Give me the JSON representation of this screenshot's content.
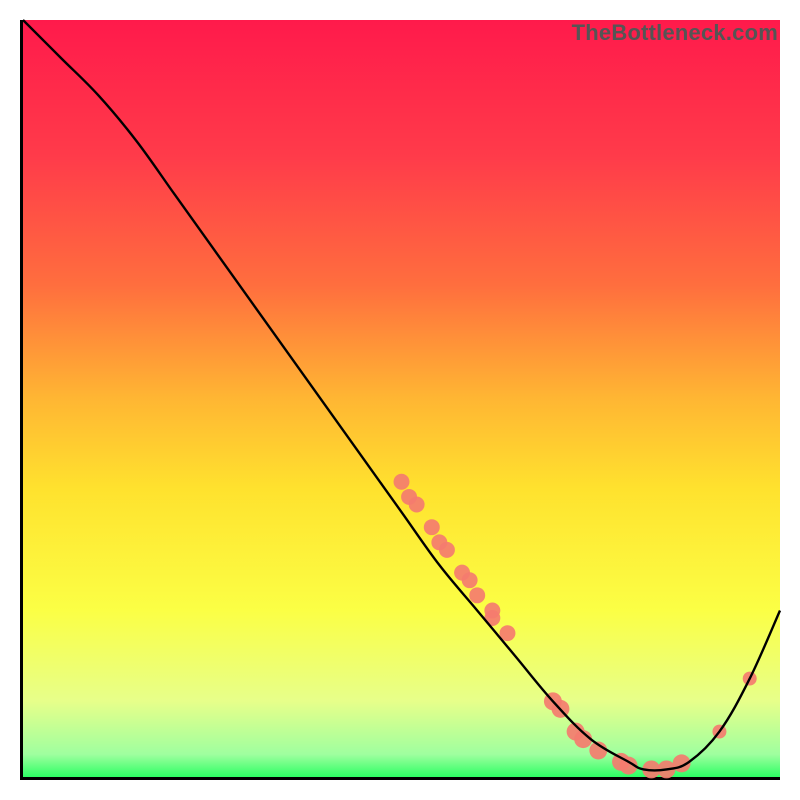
{
  "watermark": "TheBottleneck.com",
  "chart_data": {
    "type": "line",
    "title": "",
    "xlabel": "",
    "ylabel": "",
    "xlim": [
      0,
      100
    ],
    "ylim": [
      0,
      100
    ],
    "grid": false,
    "legend": false,
    "gradient_stops": [
      {
        "offset": 0,
        "color": "#ff1a4b"
      },
      {
        "offset": 0.18,
        "color": "#ff3b4a"
      },
      {
        "offset": 0.35,
        "color": "#ff6e3e"
      },
      {
        "offset": 0.5,
        "color": "#ffb633"
      },
      {
        "offset": 0.62,
        "color": "#ffe22e"
      },
      {
        "offset": 0.78,
        "color": "#fbff45"
      },
      {
        "offset": 0.9,
        "color": "#e7ff8a"
      },
      {
        "offset": 0.97,
        "color": "#9fff9f"
      },
      {
        "offset": 1.0,
        "color": "#2dff64"
      }
    ],
    "series": [
      {
        "name": "curve",
        "x": [
          0,
          5,
          10,
          15,
          20,
          25,
          30,
          35,
          40,
          45,
          50,
          55,
          60,
          65,
          70,
          75,
          80,
          82,
          85,
          88,
          92,
          96,
          100
        ],
        "y": [
          100,
          95,
          90,
          84,
          77,
          70,
          63,
          56,
          49,
          42,
          35,
          28,
          22,
          16,
          10,
          5,
          2,
          1,
          1,
          2,
          6,
          13,
          22
        ]
      }
    ],
    "marker_groups": [
      {
        "color": "#f47c6f",
        "radius": 8,
        "points": [
          {
            "x": 50,
            "y": 39
          },
          {
            "x": 51,
            "y": 37
          },
          {
            "x": 52,
            "y": 36
          },
          {
            "x": 54,
            "y": 33
          },
          {
            "x": 55,
            "y": 31
          },
          {
            "x": 56,
            "y": 30
          },
          {
            "x": 58,
            "y": 27
          },
          {
            "x": 59,
            "y": 26
          },
          {
            "x": 60,
            "y": 24
          },
          {
            "x": 62,
            "y": 22
          },
          {
            "x": 62,
            "y": 21
          },
          {
            "x": 64,
            "y": 19
          }
        ]
      },
      {
        "color": "#f47c6f",
        "radius": 9,
        "points": [
          {
            "x": 70,
            "y": 10
          },
          {
            "x": 71,
            "y": 9
          },
          {
            "x": 73,
            "y": 6
          },
          {
            "x": 74,
            "y": 5
          },
          {
            "x": 76,
            "y": 3.5
          },
          {
            "x": 79,
            "y": 2
          },
          {
            "x": 80,
            "y": 1.5
          },
          {
            "x": 83,
            "y": 1
          },
          {
            "x": 85,
            "y": 1
          },
          {
            "x": 87,
            "y": 1.8
          }
        ]
      },
      {
        "color": "#f47c6f",
        "radius": 7,
        "points": [
          {
            "x": 92,
            "y": 6
          },
          {
            "x": 96,
            "y": 13
          }
        ]
      }
    ]
  }
}
